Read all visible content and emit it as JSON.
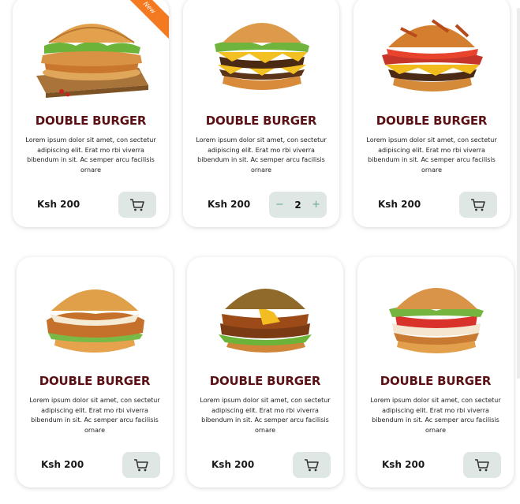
{
  "colors": {
    "title": "#5a1014",
    "button_bg": "#dfe7e5",
    "stepper_text": "#6aa89a",
    "ribbon": "#f47a21"
  },
  "products": [
    {
      "badge": "New",
      "title": "DOUBLE BURGER",
      "description": "Lorem ipsum dolor sit amet, con sectetur adipiscing elit. Erat mo rbi viverra bibendum in sit. Ac semper arcu facilisis ornare",
      "price": "Ksh 200",
      "action": "cart",
      "image_icon": "crispy-chicken-burger-icon"
    },
    {
      "title": "DOUBLE BURGER",
      "description": "Lorem ipsum dolor sit amet, con sectetur adipiscing elit. Erat mo rbi viverra bibendum in sit. Ac semper arcu facilisis ornare",
      "price": "Ksh 200",
      "action": "stepper",
      "stepper": {
        "minus": "−",
        "quantity": "2",
        "plus": "+"
      },
      "image_icon": "double-cheeseburger-icon"
    },
    {
      "title": "DOUBLE BURGER",
      "description": "Lorem ipsum dolor sit amet, con sectetur adipiscing elit. Erat mo rbi viverra bibendum in sit. Ac semper arcu facilisis ornare",
      "price": "Ksh 200",
      "action": "cart",
      "image_icon": "bacon-cheeseburger-icon"
    },
    {
      "title": "DOUBLE BURGER",
      "description": "Lorem ipsum dolor sit amet, con sectetur adipiscing elit. Erat mo rbi viverra bibendum in sit. Ac semper arcu facilisis ornare",
      "price": "Ksh 200",
      "action": "cart",
      "image_icon": "fried-chicken-burger-icon"
    },
    {
      "title": "DOUBLE BURGER",
      "description": "Lorem ipsum dolor sit amet, con sectetur adipiscing elit. Erat mo rbi viverra bibendum in sit. Ac semper arcu facilisis ornare",
      "price": "Ksh 200",
      "action": "cart",
      "image_icon": "stacked-crispy-burger-icon"
    },
    {
      "title": "DOUBLE BURGER",
      "description": "Lorem ipsum dolor sit amet, con sectetur adipiscing elit. Erat mo rbi viverra bibendum in sit. Ac semper arcu facilisis ornare",
      "price": "Ksh 200",
      "action": "cart",
      "image_icon": "tomato-chicken-burger-icon"
    }
  ]
}
